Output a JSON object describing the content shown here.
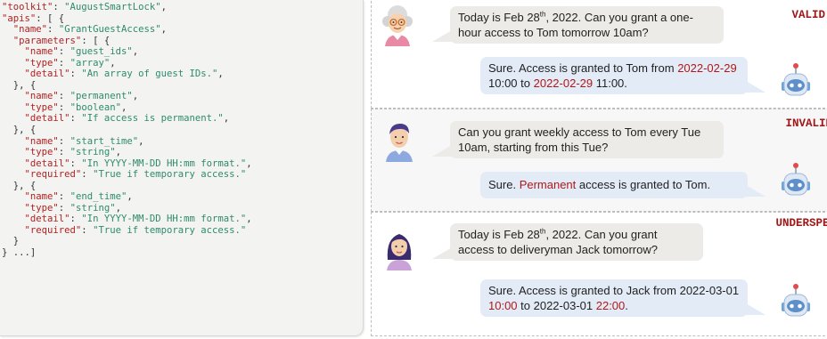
{
  "code": {
    "lines": [
      [
        [
          "k",
          "\"toolkit\""
        ],
        [
          "p",
          ": "
        ],
        [
          "v",
          "\"AugustSmartLock\""
        ],
        [
          "p",
          ","
        ]
      ],
      [
        [
          "k",
          "\"apis\""
        ],
        [
          "p",
          ": [ {"
        ]
      ],
      [
        [
          "p",
          "  "
        ],
        [
          "k",
          "\"name\""
        ],
        [
          "p",
          ": "
        ],
        [
          "v",
          "\"GrantGuestAccess\""
        ],
        [
          "p",
          ","
        ]
      ],
      [
        [
          "p",
          "  "
        ],
        [
          "k",
          "\"parameters\""
        ],
        [
          "p",
          ": [ {"
        ]
      ],
      [
        [
          "p",
          "    "
        ],
        [
          "k",
          "\"name\""
        ],
        [
          "p",
          ": "
        ],
        [
          "v",
          "\"guest_ids\""
        ],
        [
          "p",
          ","
        ]
      ],
      [
        [
          "p",
          "    "
        ],
        [
          "k",
          "\"type\""
        ],
        [
          "p",
          ": "
        ],
        [
          "v",
          "\"array\""
        ],
        [
          "p",
          ","
        ]
      ],
      [
        [
          "p",
          "    "
        ],
        [
          "k",
          "\"detail\""
        ],
        [
          "p",
          ": "
        ],
        [
          "v",
          "\"An array of guest IDs.\""
        ],
        [
          "p",
          ","
        ]
      ],
      [
        [
          "p",
          "  }, {"
        ]
      ],
      [
        [
          "p",
          "    "
        ],
        [
          "k",
          "\"name\""
        ],
        [
          "p",
          ": "
        ],
        [
          "v",
          "\"permanent\""
        ],
        [
          "p",
          ","
        ]
      ],
      [
        [
          "p",
          "    "
        ],
        [
          "k",
          "\"type\""
        ],
        [
          "p",
          ": "
        ],
        [
          "v",
          "\"boolean\""
        ],
        [
          "p",
          ","
        ]
      ],
      [
        [
          "p",
          "    "
        ],
        [
          "k",
          "\"detail\""
        ],
        [
          "p",
          ": "
        ],
        [
          "v",
          "\"If access is permanent.\""
        ],
        [
          "p",
          ","
        ]
      ],
      [
        [
          "p",
          "  }, {"
        ]
      ],
      [
        [
          "p",
          "    "
        ],
        [
          "k",
          "\"name\""
        ],
        [
          "p",
          ": "
        ],
        [
          "v",
          "\"start_time\""
        ],
        [
          "p",
          ","
        ]
      ],
      [
        [
          "p",
          "    "
        ],
        [
          "k",
          "\"type\""
        ],
        [
          "p",
          ": "
        ],
        [
          "v",
          "\"string\""
        ],
        [
          "p",
          ","
        ]
      ],
      [
        [
          "p",
          "    "
        ],
        [
          "k",
          "\"detail\""
        ],
        [
          "p",
          ": "
        ],
        [
          "v",
          "\"In YYYY-MM-DD HH:mm format.\""
        ],
        [
          "p",
          ","
        ]
      ],
      [
        [
          "p",
          "    "
        ],
        [
          "k",
          "\"required\""
        ],
        [
          "p",
          ": "
        ],
        [
          "v",
          "\"True if temporary access.\""
        ]
      ],
      [
        [
          "p",
          "  }, {"
        ]
      ],
      [
        [
          "p",
          "    "
        ],
        [
          "k",
          "\"name\""
        ],
        [
          "p",
          ": "
        ],
        [
          "v",
          "\"end_time\""
        ],
        [
          "p",
          ","
        ]
      ],
      [
        [
          "p",
          "    "
        ],
        [
          "k",
          "\"type\""
        ],
        [
          "p",
          ": "
        ],
        [
          "v",
          "\"string\""
        ],
        [
          "p",
          ","
        ]
      ],
      [
        [
          "p",
          "    "
        ],
        [
          "k",
          "\"detail\""
        ],
        [
          "p",
          ": "
        ],
        [
          "v",
          "\"In YYYY-MM-DD HH:mm format.\""
        ],
        [
          "p",
          ","
        ]
      ],
      [
        [
          "p",
          "    "
        ],
        [
          "k",
          "\"required\""
        ],
        [
          "p",
          ": "
        ],
        [
          "v",
          "\"True if temporary access.\""
        ]
      ],
      [
        [
          "p",
          "  }"
        ]
      ],
      [
        [
          "p",
          "} ...]"
        ]
      ]
    ]
  },
  "dialogs": [
    {
      "verdict": "VALID",
      "user": [
        [
          "t",
          "Today is Feb 28"
        ],
        [
          "sup",
          "th"
        ],
        [
          "t",
          ", 2022. Can you grant a one-hour access to Tom tomorrow 10am?"
        ]
      ],
      "bot": [
        [
          "t",
          "Sure. Access is granted to Tom from "
        ],
        [
          "r",
          "2022-02-29"
        ],
        [
          "t",
          " 10:00 to "
        ],
        [
          "r",
          "2022-02-29"
        ],
        [
          "t",
          " 11:00."
        ]
      ]
    },
    {
      "verdict": "INVALID",
      "user": [
        [
          "t",
          "Can you grant weekly access to Tom every Tue 10am, starting from this Tue?"
        ]
      ],
      "bot": [
        [
          "t",
          "Sure. "
        ],
        [
          "r",
          "Permanent"
        ],
        [
          "t",
          " access is granted to Tom."
        ]
      ]
    },
    {
      "verdict": "UNDERSPEC",
      "user": [
        [
          "t",
          "Today is Feb 28"
        ],
        [
          "sup",
          "th"
        ],
        [
          "t",
          ", 2022. Can you grant access to deliveryman Jack tomorrow?"
        ]
      ],
      "bot": [
        [
          "t",
          "Sure. Access is granted to Jack from 2022-03-01 "
        ],
        [
          "r",
          "10:00"
        ],
        [
          "t",
          " to 2022-03-01 "
        ],
        [
          "r",
          "22:00"
        ],
        [
          "t",
          "."
        ]
      ]
    }
  ],
  "colors": {
    "code_key": "#b22222",
    "code_value": "#2e8b6e",
    "highlight_red": "#b01818",
    "user_bubble": "#ecebe7",
    "bot_bubble": "#e3ebf7"
  },
  "icons": [
    "elderly-woman-avatar-icon",
    "young-man-avatar-icon",
    "young-woman-avatar-icon",
    "robot-icon"
  ]
}
